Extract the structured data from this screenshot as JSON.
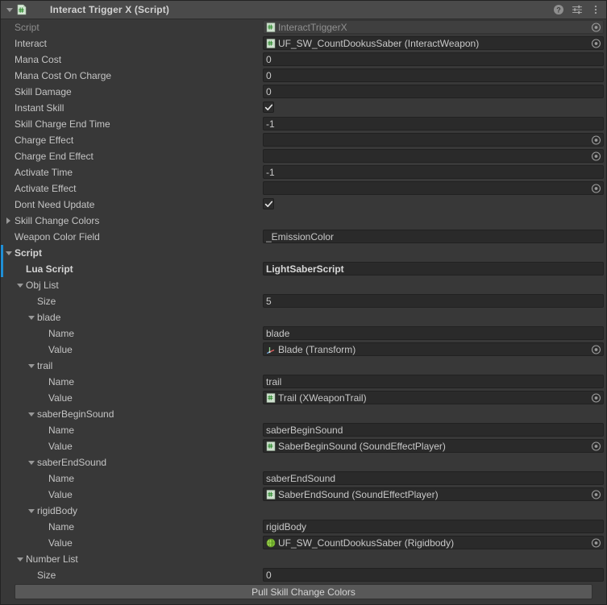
{
  "window": {
    "component_title": "Interact Trigger X (Script)",
    "foldout_state": "expanded",
    "icons": {
      "component": "csharp-script-icon",
      "help": "help-icon",
      "preset": "preset-settings-icon",
      "menu": "kebab-menu-icon"
    }
  },
  "accent_color": "#1f8fd6",
  "rows": [
    {
      "label": "Script",
      "indent": 0,
      "kind": "objref",
      "value": "InteractTriggerX",
      "icon": "csharp-script-icon",
      "readonly": true,
      "dim_label": true
    },
    {
      "label": "Interact",
      "indent": 0,
      "kind": "objref",
      "value": "UF_SW_CountDookusSaber (InteractWeapon)",
      "icon": "csharp-script-icon"
    },
    {
      "label": "Mana Cost",
      "indent": 0,
      "kind": "text",
      "value": "0"
    },
    {
      "label": "Mana Cost On Charge",
      "indent": 0,
      "kind": "text",
      "value": "0"
    },
    {
      "label": "Skill Damage",
      "indent": 0,
      "kind": "text",
      "value": "0"
    },
    {
      "label": "Instant Skill",
      "indent": 0,
      "kind": "checkbox",
      "checked": true
    },
    {
      "label": "Skill Charge End Time",
      "indent": 0,
      "kind": "text",
      "value": "-1"
    },
    {
      "label": "Charge Effect",
      "indent": 0,
      "kind": "objref",
      "value": ""
    },
    {
      "label": "Charge End Effect",
      "indent": 0,
      "kind": "objref",
      "value": ""
    },
    {
      "label": "Activate Time",
      "indent": 0,
      "kind": "text",
      "value": "-1"
    },
    {
      "label": "Activate Effect",
      "indent": 0,
      "kind": "objref",
      "value": ""
    },
    {
      "label": "Dont Need Update",
      "indent": 0,
      "kind": "checkbox",
      "checked": true
    },
    {
      "label": "Skill Change Colors",
      "indent": 0,
      "kind": "foldout",
      "foldout": "collapsed"
    },
    {
      "label": "Weapon Color Field",
      "indent": 0,
      "kind": "text",
      "value": "_EmissionColor"
    },
    {
      "label": "Script",
      "indent": 0,
      "kind": "foldout",
      "foldout": "expanded",
      "bold": true,
      "selected": true
    },
    {
      "label": "Lua Script",
      "indent": 1,
      "kind": "text",
      "value": "LightSaberScript",
      "bold": true,
      "value_bold": true,
      "selected": true
    },
    {
      "label": "Obj List",
      "indent": 1,
      "kind": "foldout",
      "foldout": "expanded"
    },
    {
      "label": "Size",
      "indent": 2,
      "kind": "text",
      "value": "5"
    },
    {
      "label": "blade",
      "indent": 2,
      "kind": "foldout",
      "foldout": "expanded"
    },
    {
      "label": "Name",
      "indent": 3,
      "kind": "text",
      "value": "blade"
    },
    {
      "label": "Value",
      "indent": 3,
      "kind": "objref",
      "value": "Blade (Transform)",
      "icon": "transform-icon"
    },
    {
      "label": "trail",
      "indent": 2,
      "kind": "foldout",
      "foldout": "expanded"
    },
    {
      "label": "Name",
      "indent": 3,
      "kind": "text",
      "value": "trail"
    },
    {
      "label": "Value",
      "indent": 3,
      "kind": "objref",
      "value": "Trail (XWeaponTrail)",
      "icon": "csharp-script-icon"
    },
    {
      "label": "saberBeginSound",
      "indent": 2,
      "kind": "foldout",
      "foldout": "expanded"
    },
    {
      "label": "Name",
      "indent": 3,
      "kind": "text",
      "value": "saberBeginSound"
    },
    {
      "label": "Value",
      "indent": 3,
      "kind": "objref",
      "value": "SaberBeginSound (SoundEffectPlayer)",
      "icon": "csharp-script-icon"
    },
    {
      "label": "saberEndSound",
      "indent": 2,
      "kind": "foldout",
      "foldout": "expanded"
    },
    {
      "label": "Name",
      "indent": 3,
      "kind": "text",
      "value": "saberEndSound"
    },
    {
      "label": "Value",
      "indent": 3,
      "kind": "objref",
      "value": "SaberEndSound (SoundEffectPlayer)",
      "icon": "csharp-script-icon"
    },
    {
      "label": "rigidBody",
      "indent": 2,
      "kind": "foldout",
      "foldout": "expanded"
    },
    {
      "label": "Name",
      "indent": 3,
      "kind": "text",
      "value": "rigidBody"
    },
    {
      "label": "Value",
      "indent": 3,
      "kind": "objref",
      "value": "UF_SW_CountDookusSaber (Rigidbody)",
      "icon": "rigidbody-icon"
    },
    {
      "label": "Number List",
      "indent": 1,
      "kind": "foldout",
      "foldout": "expanded"
    },
    {
      "label": "Size",
      "indent": 2,
      "kind": "text",
      "value": "0"
    }
  ],
  "footer": {
    "button_label": "Pull Skill Change Colors"
  }
}
